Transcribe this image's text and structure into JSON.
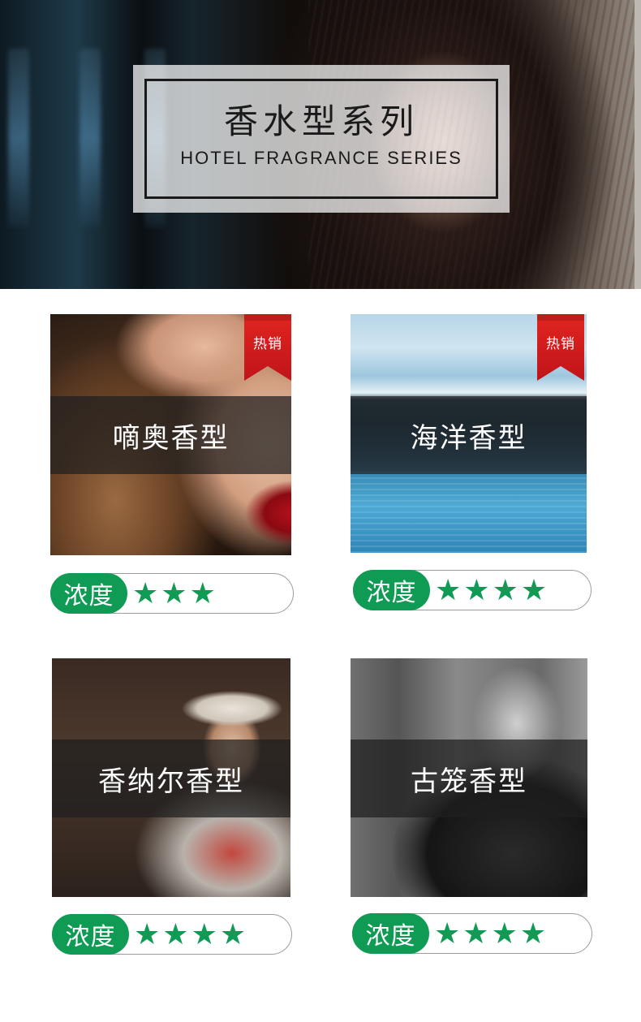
{
  "banner": {
    "title_cn": "香水型系列",
    "title_en": "HOTEL FRAGRANCE SERIES"
  },
  "products": [
    {
      "name": "嘀奥香型",
      "hot_label": "热销",
      "is_hot": true,
      "density_label": "浓度",
      "density_stars": 3,
      "image": "woman-red-lips"
    },
    {
      "name": "海洋香型",
      "hot_label": "热销",
      "is_hot": true,
      "density_label": "浓度",
      "density_stars": 4,
      "image": "ocean-pool"
    },
    {
      "name": "香纳尔香型",
      "is_hot": false,
      "density_label": "浓度",
      "density_stars": 4,
      "image": "runway-model-hat"
    },
    {
      "name": "古笼香型",
      "is_hot": false,
      "density_label": "浓度",
      "density_stars": 4,
      "image": "man-smiling-bw"
    }
  ],
  "icons": {
    "star": "star-icon",
    "hot_ribbon": "ribbon-badge"
  },
  "colors": {
    "accent_green": "#109b55",
    "hot_red": "#d81c1c"
  }
}
